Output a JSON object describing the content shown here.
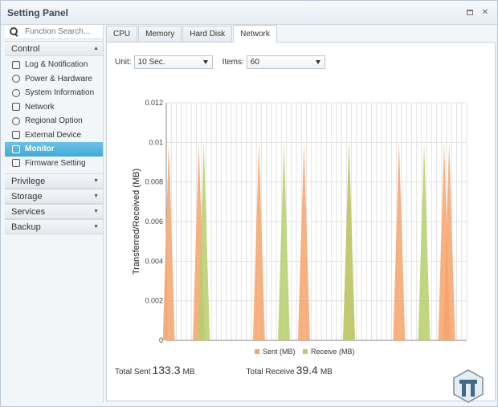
{
  "window": {
    "title": "Setting Panel"
  },
  "sidebar": {
    "search_placeholder": "Function Search...",
    "sections": [
      {
        "label": "Control",
        "expanded": true
      },
      {
        "label": "Privilege"
      },
      {
        "label": "Storage"
      },
      {
        "label": "Services"
      },
      {
        "label": "Backup"
      }
    ],
    "items": [
      {
        "label": "Log & Notification",
        "icon": "checklist-icon"
      },
      {
        "label": "Power & Hardware",
        "icon": "power-icon"
      },
      {
        "label": "System Information",
        "icon": "info-icon"
      },
      {
        "label": "Network",
        "icon": "network-icon"
      },
      {
        "label": "Regional Option",
        "icon": "globe-icon"
      },
      {
        "label": "External Device",
        "icon": "usb-icon"
      },
      {
        "label": "Monitor",
        "icon": "monitor-icon",
        "active": true
      },
      {
        "label": "Firmware Setting",
        "icon": "firmware-icon"
      }
    ]
  },
  "tabs": [
    {
      "label": "CPU"
    },
    {
      "label": "Memory"
    },
    {
      "label": "Hard Disk"
    },
    {
      "label": "Network",
      "active": true
    }
  ],
  "toolbar": {
    "unit_label": "Unit:",
    "unit_value": "10 Sec.",
    "items_label": "Items:",
    "items_value": "60"
  },
  "chart_data": {
    "type": "area",
    "ylabel": "Transferred/Received (MB)",
    "ylim": [
      0,
      0.012
    ],
    "yticks": [
      "0",
      "0.002",
      "0.004",
      "0.006",
      "0.008",
      "0.01",
      "0.012"
    ],
    "points": 60,
    "grid": true,
    "legend_position": "bottom",
    "series": [
      {
        "name": "Sent (MB)",
        "color": "#f7a36b",
        "spikes": [
          0,
          6,
          18,
          27,
          36,
          46,
          55,
          56
        ],
        "value": 0.01
      },
      {
        "name": "Receive (MB)",
        "color": "#b7cf6c",
        "spikes": [
          7,
          23,
          36,
          51
        ],
        "value": 0.01
      }
    ]
  },
  "totals": {
    "sent_label": "Total Sent",
    "sent_value": "133.3",
    "sent_unit": "MB",
    "receive_label": "Total Receive",
    "receive_value": "39.4",
    "receive_unit": "MB"
  }
}
